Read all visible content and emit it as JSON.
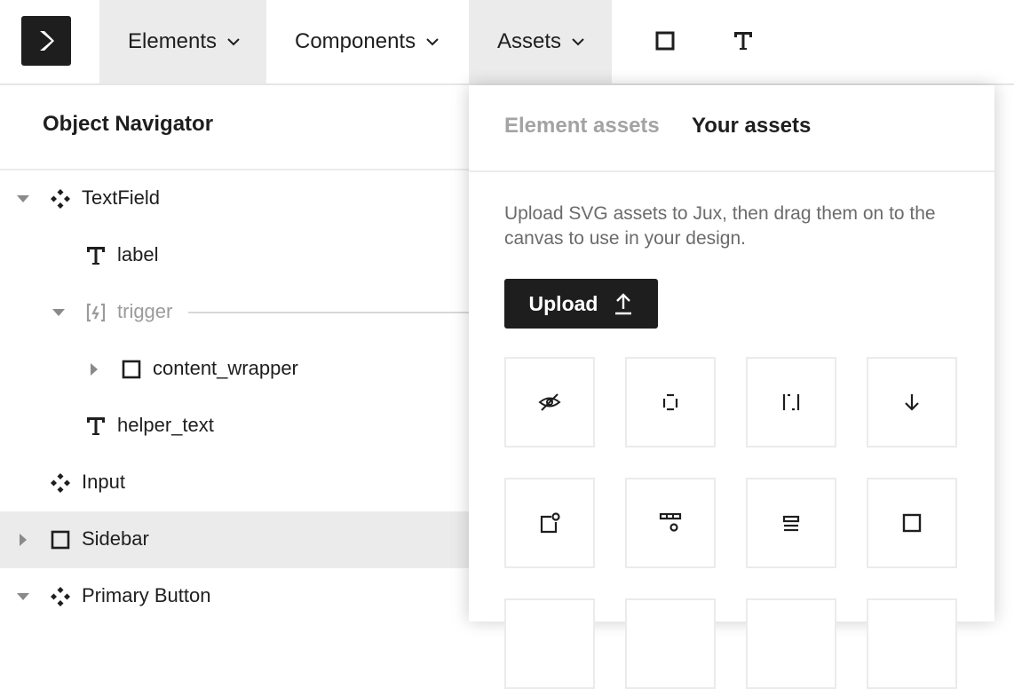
{
  "topbar": {
    "menus": [
      {
        "label": "Elements"
      },
      {
        "label": "Components"
      },
      {
        "label": "Assets"
      }
    ]
  },
  "navigator": {
    "title": "Object Navigator",
    "rows": [
      {
        "label": "TextField",
        "icon": "component-icon",
        "expanded": true
      },
      {
        "label": "label",
        "icon": "text-icon"
      },
      {
        "label": "trigger",
        "icon": "trigger-icon",
        "expanded": true,
        "muted": true
      },
      {
        "label": "content_wrapper",
        "icon": "frame-icon",
        "expanded": false
      },
      {
        "label": "helper_text",
        "icon": "text-icon"
      },
      {
        "label": "Input",
        "icon": "component-icon"
      },
      {
        "label": "Sidebar",
        "icon": "frame-icon",
        "expanded": false,
        "selected": true
      },
      {
        "label": "Primary Button",
        "icon": "component-icon",
        "expanded": true
      }
    ]
  },
  "assets_panel": {
    "tabs": [
      {
        "label": "Element assets",
        "active": false
      },
      {
        "label": "Your assets",
        "active": true
      }
    ],
    "description": "Upload SVG assets to Jux, then drag them on to the canvas to use in your design.",
    "upload_label": "Upload",
    "assets": [
      "eye-off-icon",
      "frame-corners-icon",
      "frame-sides-icon",
      "arrow-down-icon",
      "frame-badge-icon",
      "component-dots-icon",
      "align-center-icon",
      "square-icon"
    ]
  },
  "colors": {
    "text": "#1e1e1e",
    "muted": "#9b9b9b",
    "active_bg": "#ebebeb",
    "button_bg": "#1e1e1e"
  }
}
